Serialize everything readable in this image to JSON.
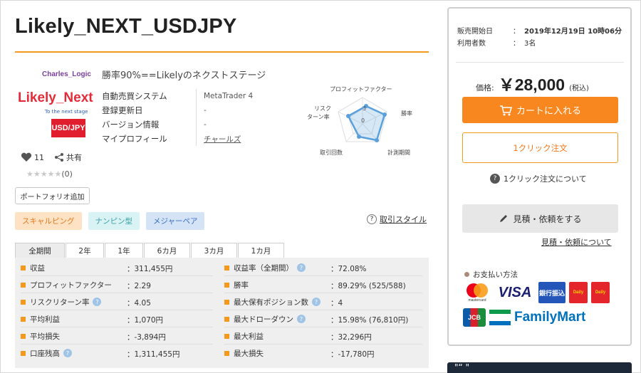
{
  "title": "Likely_NEXT_USDJPY",
  "logo": {
    "brand": "Charles_Logic",
    "name": "Likely_Next",
    "tagline": "To the next stage",
    "pair": "USD/JPY"
  },
  "social": {
    "likes": "11",
    "share_label": "共有",
    "rating_count": "(0)"
  },
  "portfolio_button": "ポートフォリオ追加",
  "subtitle": "勝率90%==Likelyのネクストステージ",
  "specs": [
    {
      "label": "自動売買システム",
      "value": "MetaTrader 4"
    },
    {
      "label": "登録更新日",
      "value": "-"
    },
    {
      "label": "バージョン情報",
      "value": "-"
    },
    {
      "label": "マイプロフィール",
      "value": "チャールズ"
    }
  ],
  "radar": {
    "labels": [
      "プロフィットファクター",
      "勝率",
      "計測期間",
      "取引回数",
      "リスク",
      "ターン率"
    ],
    "ring_labels": [
      "3",
      "0"
    ]
  },
  "tags": [
    "スキャルピング",
    "ナンピン型",
    "メジャーペア"
  ],
  "style_link": "取引スタイル",
  "period_tabs": [
    "全期間",
    "2年",
    "1年",
    "6カ月",
    "3カ月",
    "1カ月"
  ],
  "active_tab": "全期間",
  "stats_left": [
    {
      "label": "収益",
      "value": "：311,455円",
      "help": false
    },
    {
      "label": "プロフィットファクター",
      "value": "：2.29",
      "help": false
    },
    {
      "label": "リスクリターン率",
      "value": "：4.05",
      "help": true
    },
    {
      "label": "平均利益",
      "value": "：1,070円",
      "help": false
    },
    {
      "label": "平均損失",
      "value": "：-3,894円",
      "help": false
    },
    {
      "label": "口座残高",
      "value": "：1,311,455円",
      "help": true
    }
  ],
  "stats_right": [
    {
      "label": "収益率（全期間）",
      "value": "：72.08%",
      "help": true
    },
    {
      "label": "勝率",
      "value": "：89.29% (525/588)",
      "help": false
    },
    {
      "label": "最大保有ポジション数",
      "value": "：4",
      "help": true
    },
    {
      "label": "最大ドローダウン",
      "value": "：15.98% (76,810円)",
      "help": true
    },
    {
      "label": "最大利益",
      "value": "：32,296円",
      "help": false
    },
    {
      "label": "最大損失",
      "value": "：-17,780円",
      "help": false
    }
  ],
  "sidebar": {
    "sale_start_label": "販売開始日",
    "sale_start_colon": "：",
    "sale_start_value": "2019年12月19日 10時06分",
    "users_label": "利用者数",
    "users_colon": "：",
    "users_value": "3名",
    "price_label": "価格:",
    "price_value": "￥28,000",
    "price_tax": "(税込)",
    "cart_button": "カートに入れる",
    "oneclick_button": "1クリック注文",
    "oneclick_help": "1クリック注文について",
    "quote_button": "見積・依頼をする",
    "quote_link": "見積・依頼について",
    "payment_title": "お支払い方法",
    "payment_methods": [
      "mastercard",
      "VISA",
      "銀行振込",
      "Daily",
      "Daily",
      "JCB",
      "FamilyMart"
    ]
  },
  "banner_text": "\"“   \""
}
